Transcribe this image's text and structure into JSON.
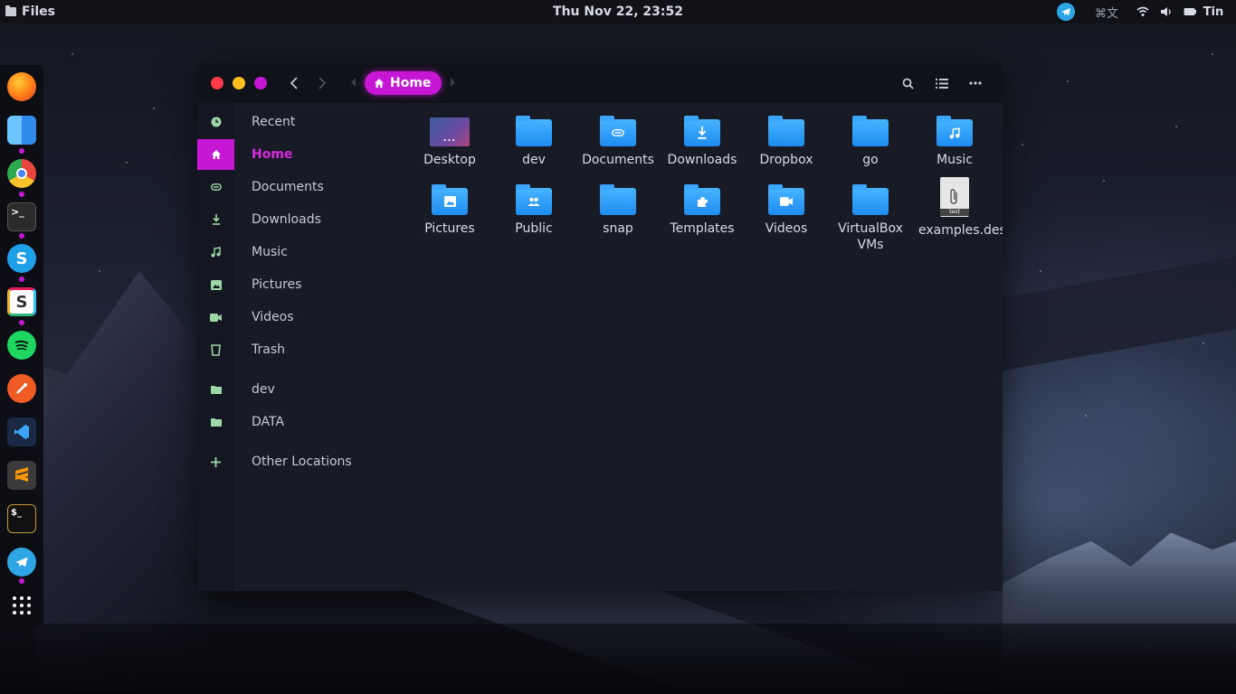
{
  "topbar": {
    "app_name": "Files",
    "clock": "Thu Nov 22, 23:52",
    "keyboard_indicator": "⌘文",
    "user": "Tin"
  },
  "dock": {
    "items": [
      {
        "name": "firefox-icon",
        "color": "#ff7a18"
      },
      {
        "name": "finder-icon",
        "color": "#2f8ae8"
      },
      {
        "name": "chrome-icon",
        "color": "#e8453c"
      },
      {
        "name": "terminal-icon",
        "color": "#2b2b2b"
      },
      {
        "name": "skype-icon",
        "color": "#1ea0e8"
      },
      {
        "name": "slack-icon",
        "color": "#ffffff"
      },
      {
        "name": "spotify-icon",
        "color": "#1ed760"
      },
      {
        "name": "postman-icon",
        "color": "#ef5b25"
      },
      {
        "name": "vscode-icon",
        "color": "#1b2a44"
      },
      {
        "name": "sublime-icon",
        "color": "#3b3b3b"
      },
      {
        "name": "terminal2-icon",
        "color": "#111111"
      },
      {
        "name": "telegram-icon",
        "color": "#2ea6e6"
      },
      {
        "name": "app-grid-icon",
        "color": "#ffffff"
      }
    ]
  },
  "window": {
    "breadcrumb_label": "Home",
    "accent": "#c517d4",
    "sidebar": [
      {
        "label": "Recent",
        "icon": "clock-icon"
      },
      {
        "label": "Home",
        "icon": "home-icon",
        "active": true
      },
      {
        "label": "Documents",
        "icon": "paperclip-icon"
      },
      {
        "label": "Downloads",
        "icon": "download-icon"
      },
      {
        "label": "Music",
        "icon": "music-icon"
      },
      {
        "label": "Pictures",
        "icon": "image-icon"
      },
      {
        "label": "Videos",
        "icon": "video-icon"
      },
      {
        "label": "Trash",
        "icon": "trash-icon"
      },
      {
        "label": "dev",
        "icon": "folder-icon"
      },
      {
        "label": "DATA",
        "icon": "folder-icon"
      },
      {
        "label": "Other Locations",
        "icon": "plus-icon"
      }
    ],
    "files": [
      {
        "name": "Desktop",
        "type": "desktop",
        "glyph": "..."
      },
      {
        "name": "dev",
        "type": "folder",
        "glyph": ""
      },
      {
        "name": "Documents",
        "type": "folder",
        "glyph": "📎"
      },
      {
        "name": "Downloads",
        "type": "folder",
        "glyph": "⤓"
      },
      {
        "name": "Dropbox",
        "type": "folder",
        "glyph": ""
      },
      {
        "name": "go",
        "type": "folder",
        "glyph": ""
      },
      {
        "name": "Music",
        "type": "folder",
        "glyph": "♫"
      },
      {
        "name": "Pictures",
        "type": "folder",
        "glyph": "▣"
      },
      {
        "name": "Public",
        "type": "folder",
        "glyph": "👥"
      },
      {
        "name": "snap",
        "type": "folder",
        "glyph": ""
      },
      {
        "name": "Templates",
        "type": "folder",
        "glyph": "✱"
      },
      {
        "name": "Videos",
        "type": "folder",
        "glyph": "■"
      },
      {
        "name": "VirtualBox VMs",
        "type": "folder",
        "glyph": ""
      },
      {
        "name": "examples.desktop",
        "type": "file",
        "glyph": "text"
      }
    ]
  }
}
